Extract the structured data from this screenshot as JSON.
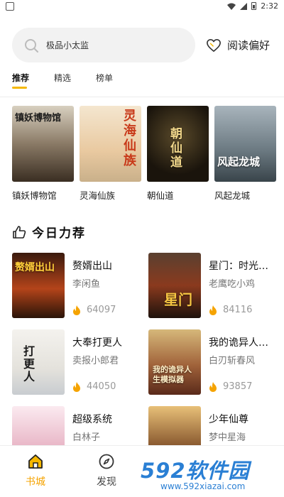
{
  "status_bar": {
    "time": "2:32"
  },
  "search": {
    "placeholder_text": "极品小太监",
    "icon": "search-icon"
  },
  "header": {
    "reading_pref_label": "阅读偏好",
    "reading_pref_icon": "heart-icon"
  },
  "tabs": [
    {
      "label": "推荐",
      "active": true
    },
    {
      "label": "精选",
      "active": false
    },
    {
      "label": "榜单",
      "active": false
    }
  ],
  "featured": [
    {
      "title": "镇妖博物馆",
      "cover_text": "镇妖博物馆"
    },
    {
      "title": "灵海仙族",
      "cover_text": "灵海仙族"
    },
    {
      "title": "朝仙道",
      "cover_text": "朝仙道"
    },
    {
      "title": "风起龙城",
      "cover_text": "风起龙城"
    }
  ],
  "section": {
    "title": "今日力荐",
    "icon": "thumbs-up-icon"
  },
  "recommendations": [
    {
      "title": "赘婿出山",
      "author": "李闲鱼",
      "heat": "64097",
      "cover_text": "赘婿出山"
    },
    {
      "title": "星门：时光之主",
      "author": "老鹰吃小鸡",
      "heat": "84116",
      "cover_text": "星门"
    },
    {
      "title": "大奉打更人",
      "author": "卖报小郎君",
      "heat": "44050",
      "cover_text": "打更人"
    },
    {
      "title": "我的诡异人生模拟器",
      "author": "白刃斩春风",
      "heat": "93857",
      "cover_text": "我的诡异人生模拟器"
    },
    {
      "title": "超级系统",
      "author": "白林子",
      "heat": "",
      "cover_text": ""
    },
    {
      "title": "少年仙尊",
      "author": "梦中星海",
      "heat": "",
      "cover_text": ""
    }
  ],
  "bottom_nav": [
    {
      "label": "书城",
      "icon": "home-icon",
      "active": true
    },
    {
      "label": "发现",
      "icon": "compass-icon",
      "active": false
    }
  ],
  "watermark": {
    "main": "592软件园",
    "sub": "www.592xiazai.com"
  },
  "colors": {
    "accent": "#f5b800",
    "nav_active": "#f5a300",
    "flame": "#f5a300",
    "watermark": "#2a7fd4"
  }
}
